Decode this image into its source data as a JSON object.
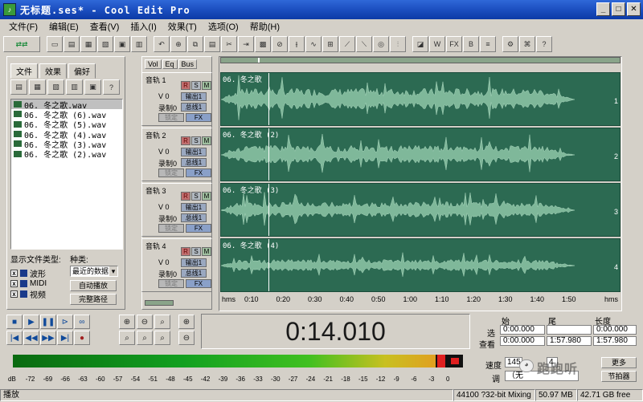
{
  "window": {
    "title": "无标题.ses* - Cool Edit Pro"
  },
  "menu": [
    "文件(F)",
    "编辑(E)",
    "查看(V)",
    "插入(I)",
    "效果(T)",
    "选项(O)",
    "帮助(H)"
  ],
  "left_panel": {
    "tabs": [
      "文件",
      "效果",
      "偏好"
    ],
    "files": [
      "06. 冬之歌.wav",
      "06. 冬之歌 (6).wav",
      "06. 冬之歌 (5).wav",
      "06. 冬之歌 (4).wav",
      "06. 冬之歌 (3).wav",
      "06. 冬之歌 (2).wav"
    ],
    "show_types_label": "显示文件类型:",
    "kind_label": "种类:",
    "types": [
      "波形",
      "MIDI",
      "视频"
    ],
    "kind_select": "最近的数据",
    "auto_play": "自动播放",
    "full_path": "完整路径"
  },
  "track_tabs": [
    "Vol",
    "Eq",
    "Bus"
  ],
  "tracks": [
    {
      "name": "音轨 1",
      "clip": "06. 冬之歌",
      "no": "1"
    },
    {
      "name": "音轨 2",
      "clip": "06. 冬之歌 (2)",
      "no": "2"
    },
    {
      "name": "音轨 3",
      "clip": "06. 冬之歌 (3)",
      "no": "3"
    },
    {
      "name": "音轨 4",
      "clip": "06. 冬之歌 (4)",
      "no": "4"
    }
  ],
  "track_controls": {
    "r": "R",
    "s": "S",
    "m": "M",
    "vol": "V 0",
    "out": "输出1",
    "rec": "录制0",
    "bus": "总线1",
    "lock": "锁定",
    "fx": "FX"
  },
  "ruler": [
    "hms",
    "0:10",
    "0:20",
    "0:30",
    "0:40",
    "0:50",
    "1:00",
    "1:10",
    "1:20",
    "1:30",
    "1:40",
    "1:50",
    "hms"
  ],
  "time_display": "0:14.010",
  "selection": {
    "hdr_start": "始",
    "hdr_end": "尾",
    "hdr_len": "长度",
    "sel_label": "选",
    "view_label": "查看",
    "sel_start": "0:00.000",
    "sel_end": "",
    "sel_len": "0:00.000",
    "view_start": "0:00.000",
    "view_end": "1:57.980",
    "view_len": "1:57.980"
  },
  "meter": {
    "scale": [
      "dB",
      "-72",
      "-69",
      "-66",
      "-63",
      "-60",
      "-57",
      "-54",
      "-51",
      "-48",
      "-45",
      "-42",
      "-39",
      "-36",
      "-33",
      "-30",
      "-27",
      "-24",
      "-21",
      "-18",
      "-15",
      "-12",
      "-9",
      "-6",
      "-3",
      "0"
    ],
    "level_fraction": 0.94
  },
  "speed": {
    "label": "速度",
    "value": "145",
    "beats": "4",
    "key_label": "调",
    "key_value": "（无",
    "more": "更多",
    "more2": "节拍器"
  },
  "watermark": "跑跑听",
  "status": {
    "mode": "播放",
    "format": "44100 ?32-bit Mixing",
    "mem": "50.97 MB",
    "disk": "42.71 GB free"
  }
}
